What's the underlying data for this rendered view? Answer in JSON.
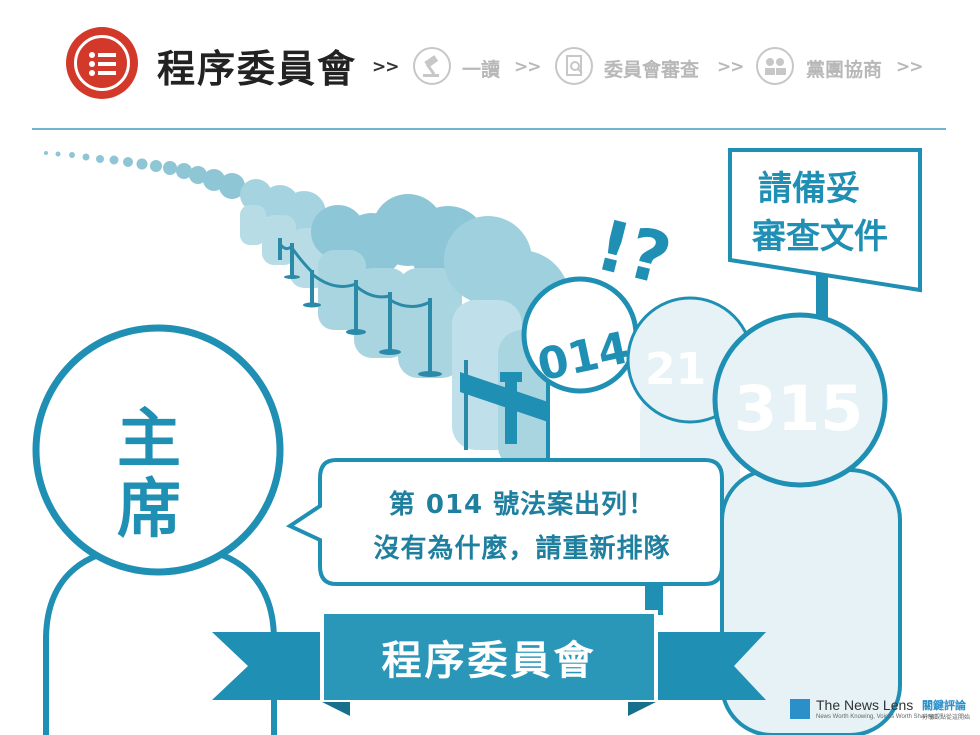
{
  "header": {
    "current_step": "程序委員會",
    "arrow": ">>",
    "steps": [
      {
        "label": "一讀",
        "icon": "gavel-icon"
      },
      {
        "label": "委員會審查",
        "icon": "document-search-icon"
      },
      {
        "label": "黨團協商",
        "icon": "group-discussion-icon"
      }
    ],
    "current_icon": "checklist-icon"
  },
  "scene": {
    "sign": {
      "line1": "請備妥",
      "line2": "審查文件"
    },
    "exclaim": "!?",
    "numbers": {
      "first": "014",
      "second": "21",
      "third": "315"
    },
    "chair": {
      "line1": "主",
      "line2": "席"
    },
    "speech": {
      "line1": "第 014 號法案出列！",
      "line2": "沒有為什麼，請重新排隊"
    },
    "banner": "程序委員會"
  },
  "brand": {
    "name": "The News Lens",
    "cn_name": "關鍵評論",
    "tagline": "News Worth Knowing, Voices Worth Sharing",
    "cn_tagline": "分享觀點從這開始"
  },
  "colors": {
    "primary": "#1f8fb3",
    "light": "#bfe0ea",
    "red": "#d3392b"
  }
}
